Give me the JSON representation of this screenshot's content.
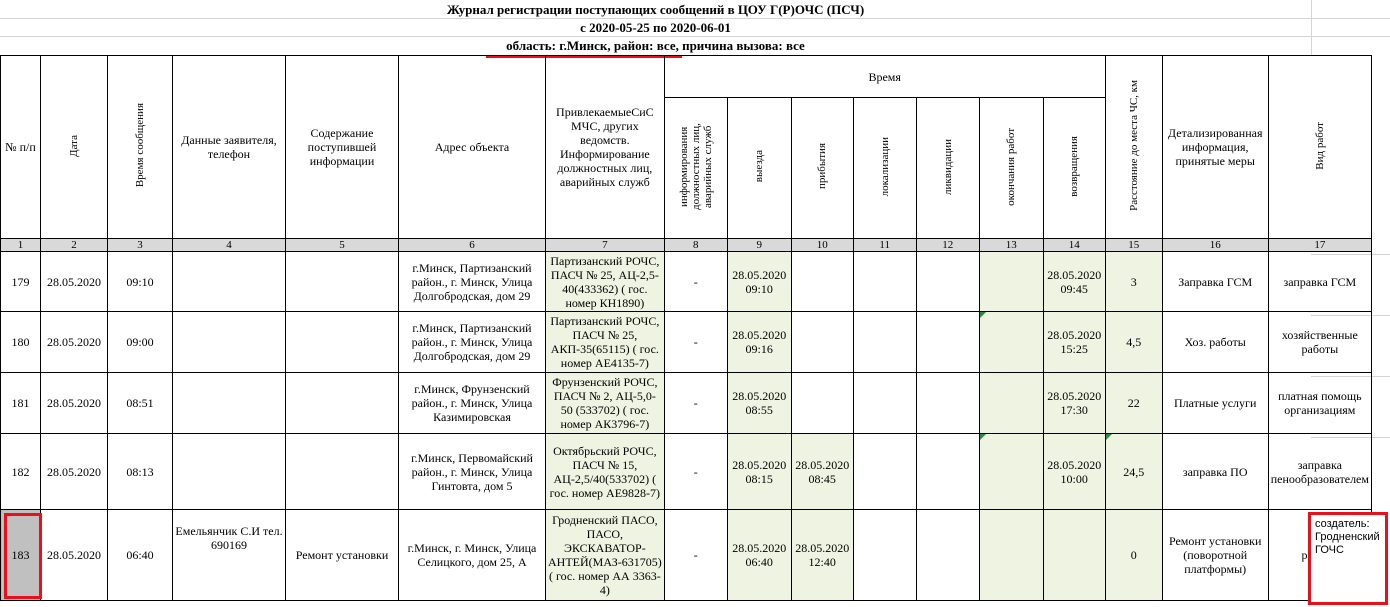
{
  "title": {
    "line1": "Журнал регистрации поступающих сообщений в ЦОУ Г(Р)ОЧС (ПСЧ)",
    "line2": "с 2020-05-25 по 2020-06-01",
    "line3": "область: г.Минск, район: все, причина вызова: все"
  },
  "headers": {
    "num": "№ п/п",
    "date": "Дата",
    "time": "Время сообщения",
    "applicant": "Данные заявителя, телефон",
    "content": "Содержание поступившей информации",
    "address": "Адрес объекта",
    "forces": "ПривлекаемыеСиС МЧС, других ведомств. Информирование должностных лиц, аварийных служб",
    "time_group": "Время",
    "informing": "информирования должностных лиц, аварийных служб",
    "departure": "выезда",
    "arrival": "прибытия",
    "localization": "локализации",
    "liquidation": "ликвидации",
    "work_end": "окончания работ",
    "return": "возвращения",
    "distance": "Расстояние до места ЧС, км",
    "details": "Детализированная информация, принятые меры",
    "work_type": "Вид работ"
  },
  "col_numbers": [
    "1",
    "2",
    "3",
    "4",
    "5",
    "6",
    "7",
    "8",
    "9",
    "10",
    "11",
    "12",
    "13",
    "14",
    "15",
    "16",
    "17"
  ],
  "rows": [
    {
      "n": "179",
      "date": "28.05.2020",
      "time": "09:10",
      "applicant": "",
      "content": "",
      "address": "г.Минск, Партизанский район., г. Минск, Улица Долгобродская, дом 29",
      "forces": "Партизанский РОЧС, ПАСЧ № 25, АЦ-2,5-40(433362) ( гос. номер КН1890)",
      "informing": "-",
      "departure": "28.05.2020 09:10",
      "arrival": "",
      "localization": "",
      "liquidation": "",
      "work_end": "",
      "return": "28.05.2020 09:45",
      "distance": "3",
      "details": "Заправка ГСМ",
      "work_type": "заправка ГСМ"
    },
    {
      "n": "180",
      "date": "28.05.2020",
      "time": "09:00",
      "applicant": "",
      "content": "",
      "address": "г.Минск, Партизанский район., г. Минск, Улица Долгобродская, дом 29",
      "forces": "Партизанский РОЧС, ПАСЧ № 25, АКП-35(65115) ( гос. номер АЕ4135-7)",
      "informing": "-",
      "departure": "28.05.2020 09:16",
      "arrival": "",
      "localization": "",
      "liquidation": "",
      "work_end": "",
      "return": "28.05.2020 15:25",
      "distance": "4,5",
      "details": "Хоз. работы",
      "work_type": "хозяйственные работы"
    },
    {
      "n": "181",
      "date": "28.05.2020",
      "time": "08:51",
      "applicant": "",
      "content": "",
      "address": "г.Минск, Фрунзенский район., г. Минск, Улица Казимировская",
      "forces": "Фрунзенский РОЧС, ПАСЧ № 2, АЦ-5,0-50 (533702) ( гос. номер АК3796-7)",
      "informing": "-",
      "departure": "28.05.2020 08:55",
      "arrival": "",
      "localization": "",
      "liquidation": "",
      "work_end": "",
      "return": "28.05.2020 17:30",
      "distance": "22",
      "details": "Платные услуги",
      "work_type": "платная помощь организациям"
    },
    {
      "n": "182",
      "date": "28.05.2020",
      "time": "08:13",
      "applicant": "",
      "content": "",
      "address": "г.Минск, Первомайский район., г. Минск, Улица Гинтовта, дом 5",
      "forces": "Октябрьский РОЧС, ПАСЧ № 15, АЦ-2,5/40(533702) ( гос. номер АЕ9828-7)",
      "informing": "-",
      "departure": "28.05.2020 08:15",
      "arrival": "28.05.2020 08:45",
      "localization": "",
      "liquidation": "",
      "work_end": "",
      "return": "28.05.2020 10:00",
      "distance": "24,5",
      "details": "заправка ПО",
      "work_type": "заправка пенообразователем"
    },
    {
      "n": "183",
      "date": "28.05.2020",
      "time": "06:40",
      "applicant": "Емельянчик С.И тел. 690169",
      "content": "Ремонт установки",
      "address": "г.Минск, г. Минск, Улица Селицкого, дом 25, А",
      "forces": "Гродненский ПАСО, ПАСО, ЭКСКАВАТОР-АНТЕЙ(МАЗ-631705) ( гос. номер АА 3363-4)",
      "informing": "-",
      "departure": "28.05.2020 06:40",
      "arrival": "28.05.2020 12:40",
      "localization": "",
      "liquidation": "",
      "work_end": "",
      "return": "",
      "distance": "0",
      "details": "Ремонт установки (поворотной платформы)",
      "work_type": "ремонт"
    }
  ],
  "comment": "создатель: Гродненский ГОЧС",
  "colors": {
    "highlight": "#e8111b",
    "green_fill": "#eef3e2",
    "header_gray": "#d9d9d9"
  }
}
